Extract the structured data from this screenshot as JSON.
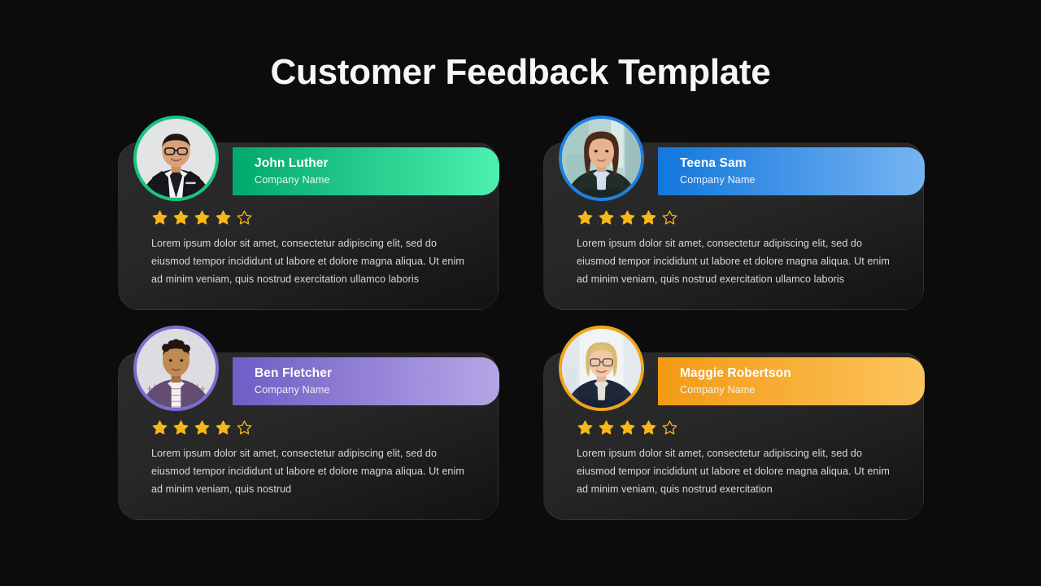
{
  "title": "Customer Feedback Template",
  "stars": {
    "filled_color": "#f5b719",
    "empty_color": "#f5b719",
    "total": 5
  },
  "cards": [
    {
      "name": "John Luther",
      "company": "Company Name",
      "rating": 4,
      "quote": "Lorem ipsum dolor sit amet, consectetur adipiscing elit, sed do eiusmod tempor incididunt ut labore et dolore magna aliqua. Ut enim ad minim veniam, quis nostrud exercitation ullamco laboris",
      "accent_start": "#00a86b",
      "accent_end": "#4df0b0",
      "ring_color": "#17c57c",
      "avatar": "man-dark-suit-glasses"
    },
    {
      "name": "Teena Sam",
      "company": "Company Name",
      "rating": 4,
      "quote": "Lorem ipsum dolor sit amet, consectetur adipiscing elit, sed do eiusmod tempor incididunt ut labore et dolore magna aliqua. Ut enim ad minim veniam, quis nostrud exercitation ullamco laboris",
      "accent_start": "#1277dd",
      "accent_end": "#76b4f2",
      "ring_color": "#1f7fe0",
      "avatar": "woman-brown-hair-blazer"
    },
    {
      "name": "Ben Fletcher",
      "company": "Company Name",
      "rating": 4,
      "quote": "Lorem ipsum dolor sit amet, consectetur adipiscing elit, sed do eiusmod tempor incididunt ut labore et dolore magna aliqua. Ut enim ad minim veniam, quis nostrud",
      "accent_start": "#6f5cc6",
      "accent_end": "#b6a6e6",
      "ring_color": "#7f6bd0",
      "avatar": "man-curly-hair-plaid-blazer"
    },
    {
      "name": "Maggie Robertson",
      "company": "Company Name",
      "rating": 4,
      "quote": "Lorem ipsum dolor sit amet, consectetur adipiscing elit, sed do eiusmod tempor incididunt ut labore et dolore magna aliqua. Ut enim ad minim veniam, quis nostrud exercitation",
      "accent_start": "#f39a14",
      "accent_end": "#fcc45c",
      "ring_color": "#f0a41d",
      "avatar": "woman-blonde-glasses-navy-blazer"
    }
  ]
}
